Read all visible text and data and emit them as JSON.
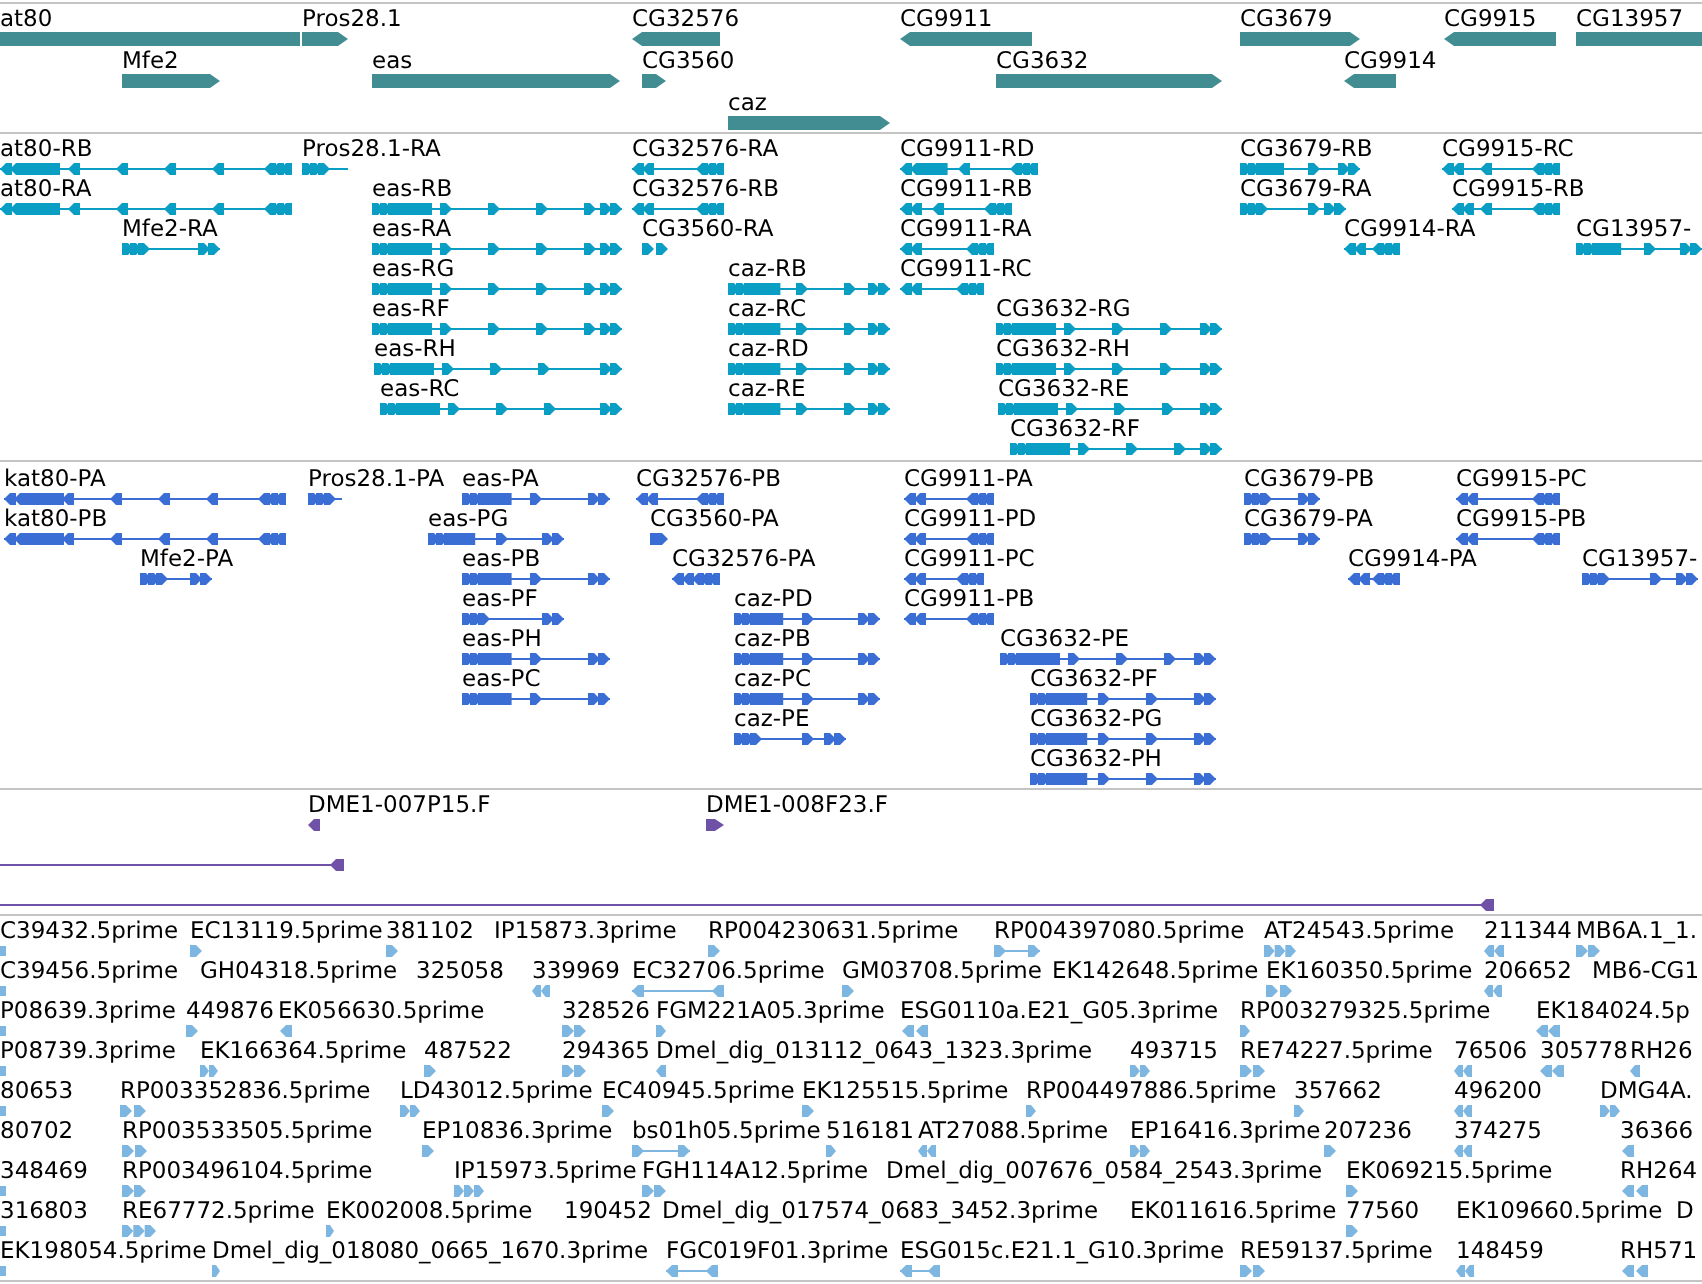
{
  "tracks": [
    {
      "kind": "gene",
      "color": "#428d92",
      "features": [
        {
          "label": "at80",
          "reverse": true
        },
        {
          "label": "Pros28.1",
          "reverse": false
        },
        {
          "label": "CG32576",
          "reverse": true
        },
        {
          "label": "CG9911",
          "reverse": true
        },
        {
          "label": "CG3679",
          "reverse": false
        },
        {
          "label": "CG9915",
          "reverse": true
        },
        {
          "label": "CG13957",
          "reverse": false
        },
        {
          "label": "Mfe2",
          "reverse": false
        },
        {
          "label": "eas",
          "reverse": false
        },
        {
          "label": "CG3560",
          "reverse": false
        },
        {
          "label": "CG3632",
          "reverse": false
        },
        {
          "label": "CG9914",
          "reverse": true
        },
        {
          "label": "caz",
          "reverse": false
        }
      ]
    },
    {
      "kind": "transcript",
      "color": "#0a9ec4",
      "features": [
        {
          "label": "at80-RB",
          "reverse": true
        },
        {
          "label": "Pros28.1-RA",
          "reverse": false
        },
        {
          "label": "CG32576-RA",
          "reverse": true
        },
        {
          "label": "CG9911-RD",
          "reverse": true
        },
        {
          "label": "CG3679-RB",
          "reverse": false
        },
        {
          "label": "CG9915-RC",
          "reverse": true
        },
        {
          "label": "at80-RA",
          "reverse": true
        },
        {
          "label": "eas-RB",
          "reverse": false
        },
        {
          "label": "CG32576-RB",
          "reverse": true
        },
        {
          "label": "CG9911-RB",
          "reverse": true
        },
        {
          "label": "CG3679-RA",
          "reverse": false
        },
        {
          "label": "CG9915-RB",
          "reverse": true
        },
        {
          "label": "Mfe2-RA",
          "reverse": false
        },
        {
          "label": "eas-RA",
          "reverse": false
        },
        {
          "label": "CG3560-RA",
          "reverse": false
        },
        {
          "label": "CG9911-RA",
          "reverse": true
        },
        {
          "label": "CG9914-RA",
          "reverse": true
        },
        {
          "label": "CG13957-",
          "reverse": false
        },
        {
          "label": "eas-RG",
          "reverse": false
        },
        {
          "label": "caz-RB",
          "reverse": false
        },
        {
          "label": "CG9911-RC",
          "reverse": true
        },
        {
          "label": "eas-RF",
          "reverse": false
        },
        {
          "label": "caz-RC",
          "reverse": false
        },
        {
          "label": "CG3632-RG",
          "reverse": false
        },
        {
          "label": "eas-RH",
          "reverse": false
        },
        {
          "label": "caz-RD",
          "reverse": false
        },
        {
          "label": "CG3632-RH",
          "reverse": false
        },
        {
          "label": "eas-RC",
          "reverse": false
        },
        {
          "label": "caz-RE",
          "reverse": false
        },
        {
          "label": "CG3632-RE",
          "reverse": false
        },
        {
          "label": "CG3632-RF",
          "reverse": false
        }
      ]
    },
    {
      "kind": "protein",
      "color": "#3a6ed4",
      "features": [
        {
          "label": "kat80-PA",
          "reverse": true
        },
        {
          "label": "Pros28.1-PA",
          "reverse": false
        },
        {
          "label": "eas-PA",
          "reverse": false
        },
        {
          "label": "CG32576-PB",
          "reverse": true
        },
        {
          "label": "CG9911-PA",
          "reverse": true
        },
        {
          "label": "CG3679-PB",
          "reverse": false
        },
        {
          "label": "CG9915-PC",
          "reverse": true
        },
        {
          "label": "kat80-PB",
          "reverse": true
        },
        {
          "label": "eas-PG",
          "reverse": false
        },
        {
          "label": "CG3560-PA",
          "reverse": false
        },
        {
          "label": "CG9911-PD",
          "reverse": true
        },
        {
          "label": "CG3679-PA",
          "reverse": false
        },
        {
          "label": "CG9915-PB",
          "reverse": true
        },
        {
          "label": "Mfe2-PA",
          "reverse": false
        },
        {
          "label": "eas-PB",
          "reverse": false
        },
        {
          "label": "CG32576-PA",
          "reverse": true
        },
        {
          "label": "CG9911-PC",
          "reverse": true
        },
        {
          "label": "CG9914-PA",
          "reverse": true
        },
        {
          "label": "CG13957-",
          "reverse": false
        },
        {
          "label": "eas-PF",
          "reverse": false
        },
        {
          "label": "caz-PD",
          "reverse": false
        },
        {
          "label": "CG9911-PB",
          "reverse": true
        },
        {
          "label": "eas-PH",
          "reverse": false
        },
        {
          "label": "caz-PB",
          "reverse": false
        },
        {
          "label": "CG3632-PE",
          "reverse": false
        },
        {
          "label": "eas-PC",
          "reverse": false
        },
        {
          "label": "caz-PC",
          "reverse": false
        },
        {
          "label": "CG3632-PF",
          "reverse": false
        },
        {
          "label": "caz-PE",
          "reverse": false
        },
        {
          "label": "CG3632-PG",
          "reverse": false
        },
        {
          "label": "CG3632-PH",
          "reverse": false
        }
      ]
    },
    {
      "kind": "clone",
      "color": "#6f52a8",
      "features": [
        {
          "label": "DME1-007P15.F",
          "reverse": true
        },
        {
          "label": "DME1-008F23.F",
          "reverse": false
        },
        {
          "reverse": true
        },
        {
          "reverse": true
        }
      ]
    },
    {
      "kind": "read",
      "color": "#7db6e0",
      "features": [
        {
          "label": "C39432.5prime"
        },
        {
          "label": "EC13119.5prime",
          "reverse": false
        },
        {
          "label": "381102",
          "reverse": false
        },
        {
          "label": "IP15873.3prime"
        },
        {
          "label": "RP004230631.5prime",
          "reverse": false
        },
        {
          "label": "RP004397080.5prime",
          "reverse": false
        },
        {
          "label": "AT24543.5prime",
          "reverse": false
        },
        {
          "label": "211344",
          "reverse": true
        },
        {
          "label": "MB6A.1_1.",
          "reverse": false
        },
        {
          "label": "C39456.5prime"
        },
        {
          "label": "GH04318.5prime"
        },
        {
          "label": "325058"
        },
        {
          "label": "339969",
          "reverse": true
        },
        {
          "label": "EC32706.5prime",
          "reverse": true
        },
        {
          "label": "GM03708.5prime",
          "reverse": false
        },
        {
          "label": "EK142648.5prime"
        },
        {
          "label": "EK160350.5prime",
          "reverse": false
        },
        {
          "label": "206652",
          "reverse": true
        },
        {
          "label": "MB6-CG1"
        },
        {
          "label": "P08639.3prime"
        },
        {
          "label": "449876",
          "reverse": false
        },
        {
          "label": "EK056630.5prime",
          "reverse": true
        },
        {
          "label": "328526",
          "reverse": false
        },
        {
          "label": "FGM221A05.3prime",
          "reverse": false
        },
        {
          "label": "ESG0110a.E21_G05.3prime",
          "reverse": true
        },
        {
          "label": "RP003279325.5prime",
          "reverse": false
        },
        {
          "label": "EK184024.5p",
          "reverse": true
        },
        {
          "label": "P08739.3prime"
        },
        {
          "label": "EK166364.5prime",
          "reverse": false
        },
        {
          "label": "487522",
          "reverse": false
        },
        {
          "label": "294365",
          "reverse": false
        },
        {
          "label": "Dmel_dig_013112_0643_1323.3prime",
          "reverse": true
        },
        {
          "label": "493715",
          "reverse": false
        },
        {
          "label": "RE74227.5prime",
          "reverse": false
        },
        {
          "label": "76506",
          "reverse": true
        },
        {
          "label": "305778",
          "reverse": true
        },
        {
          "label": "RH26",
          "reverse": true
        },
        {
          "label": "80653"
        },
        {
          "label": "RP003352836.5prime",
          "reverse": false
        },
        {
          "label": "LD43012.5prime",
          "reverse": false
        },
        {
          "label": "EC40945.5prime",
          "reverse": false
        },
        {
          "label": "EK125515.5prime",
          "reverse": false
        },
        {
          "label": "RP004497886.5prime",
          "reverse": false
        },
        {
          "label": "357662",
          "reverse": false
        },
        {
          "label": "496200",
          "reverse": true
        },
        {
          "label": "DMG4A.",
          "reverse": false
        },
        {
          "label": "80702"
        },
        {
          "label": "RP003533505.5prime",
          "reverse": false
        },
        {
          "label": "EP10836.3prime",
          "reverse": false
        },
        {
          "label": "bs01h05.5prime",
          "reverse": false
        },
        {
          "label": "516181",
          "reverse": false
        },
        {
          "label": "AT27088.5prime",
          "reverse": true
        },
        {
          "label": "EP16416.3prime",
          "reverse": false
        },
        {
          "label": "207236",
          "reverse": false
        },
        {
          "label": "374275",
          "reverse": true
        },
        {
          "label": "36366",
          "reverse": true
        },
        {
          "label": "348469"
        },
        {
          "label": "RP003496104.5prime",
          "reverse": false
        },
        {
          "label": "IP15973.5prime",
          "reverse": false
        },
        {
          "label": "FGH114A12.5prime",
          "reverse": false
        },
        {
          "label": "Dmel_dig_007676_0584_2543.3prime"
        },
        {
          "label": "EK069215.5prime",
          "reverse": false
        },
        {
          "label": "RH264",
          "reverse": true
        },
        {
          "label": "316803"
        },
        {
          "label": "RE67772.5prime",
          "reverse": false
        },
        {
          "label": "EK002008.5prime",
          "reverse": false
        },
        {
          "label": "190452"
        },
        {
          "label": "Dmel_dig_017574_0683_3452.3prime"
        },
        {
          "label": "EK011616.5prime"
        },
        {
          "label": "77560",
          "reverse": false
        },
        {
          "label": "EK109660.5prime"
        },
        {
          "label": "D"
        },
        {
          "label": "EK198054.5prime"
        },
        {
          "label": "Dmel_dig_018080_0665_1670.3prime",
          "reverse": false
        },
        {
          "label": "FGC019F01.3prime",
          "reverse": true
        },
        {
          "label": "ESG015c.E21.1_G10.3prime",
          "reverse": true
        },
        {
          "label": "RE59137.5prime",
          "reverse": false
        },
        {
          "label": "148459",
          "reverse": true
        },
        {
          "label": "RH571",
          "reverse": true
        }
      ]
    }
  ]
}
